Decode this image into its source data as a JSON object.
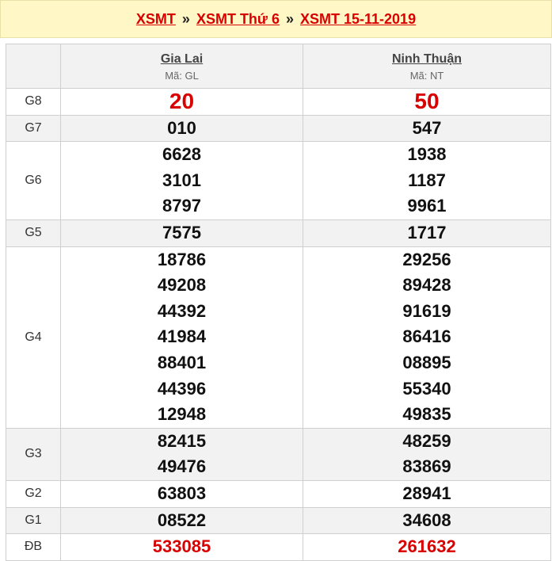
{
  "breadcrumb": {
    "item1": "XSMT",
    "item2": "XSMT Thứ 6",
    "item3": "XSMT 15-11-2019",
    "separator": "»"
  },
  "provinces": [
    {
      "name": "Gia Lai",
      "code": "Mã: GL"
    },
    {
      "name": "Ninh Thuận",
      "code": "Mã: NT"
    }
  ],
  "prizes": [
    {
      "label": "G8",
      "values": [
        [
          "20"
        ],
        [
          "50"
        ]
      ]
    },
    {
      "label": "G7",
      "values": [
        [
          "010"
        ],
        [
          "547"
        ]
      ]
    },
    {
      "label": "G6",
      "values": [
        [
          "6628",
          "3101",
          "8797"
        ],
        [
          "1938",
          "1187",
          "9961"
        ]
      ]
    },
    {
      "label": "G5",
      "values": [
        [
          "7575"
        ],
        [
          "1717"
        ]
      ]
    },
    {
      "label": "G4",
      "values": [
        [
          "18786",
          "49208",
          "44392",
          "41984",
          "88401",
          "44396",
          "12948"
        ],
        [
          "29256",
          "89428",
          "91619",
          "86416",
          "08895",
          "55340",
          "49835"
        ]
      ]
    },
    {
      "label": "G3",
      "values": [
        [
          "82415",
          "49476"
        ],
        [
          "48259",
          "83869"
        ]
      ]
    },
    {
      "label": "G2",
      "values": [
        [
          "63803"
        ],
        [
          "28941"
        ]
      ]
    },
    {
      "label": "G1",
      "values": [
        [
          "08522"
        ],
        [
          "34608"
        ]
      ]
    },
    {
      "label": "ĐB",
      "values": [
        [
          "533085"
        ],
        [
          "261632"
        ]
      ]
    }
  ],
  "colors": {
    "accent": "#d80000",
    "header_bg": "#fff7c6",
    "row_alt": "#f2f2f2"
  }
}
